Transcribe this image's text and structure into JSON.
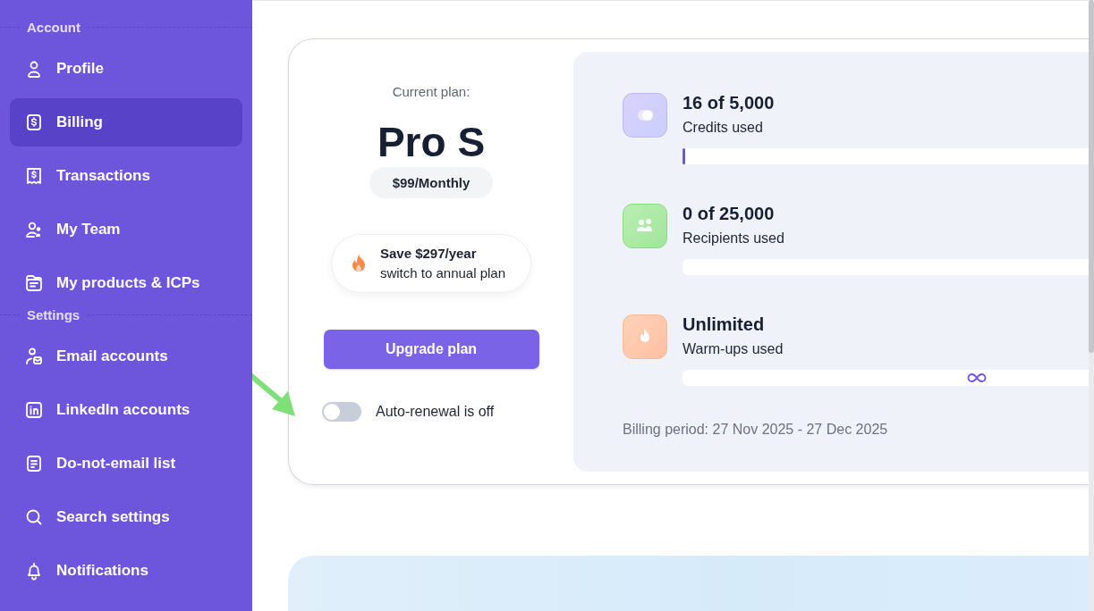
{
  "sidebar": {
    "sections": [
      {
        "title": "Account",
        "items": [
          {
            "label": "Profile",
            "selected": false
          },
          {
            "label": "Billing",
            "selected": true
          },
          {
            "label": "Transactions",
            "selected": false
          },
          {
            "label": "My Team",
            "selected": false
          },
          {
            "label": "My products & ICPs",
            "selected": false
          }
        ]
      },
      {
        "title": "Settings",
        "items": [
          {
            "label": "Email accounts",
            "selected": false
          },
          {
            "label": "LinkedIn accounts",
            "selected": false
          },
          {
            "label": "Do-not-email list",
            "selected": false
          },
          {
            "label": "Search settings",
            "selected": false
          },
          {
            "label": "Notifications",
            "selected": false
          }
        ]
      }
    ]
  },
  "plan": {
    "caption": "Current plan:",
    "name": "Pro S",
    "price": "$99/Monthly",
    "promo": {
      "title": "Save $297/year",
      "subtitle": "switch to annual plan"
    },
    "upgrade_button": "Upgrade plan",
    "auto_renewal": {
      "label": "Auto-renewal is off",
      "on": false
    }
  },
  "usage": {
    "items": [
      {
        "kind": "credits",
        "value": "16 of 5,000",
        "label": "Credits used",
        "level": 0.0032
      },
      {
        "kind": "recipients",
        "value": "0 of 25,000",
        "label": "Recipients used",
        "level": 0
      },
      {
        "kind": "unlimited",
        "value": "Unlimited",
        "label": "Warm-ups used"
      }
    ],
    "billing_period": "Billing period: 27 Nov 2025 - 27 Dec 2025"
  }
}
